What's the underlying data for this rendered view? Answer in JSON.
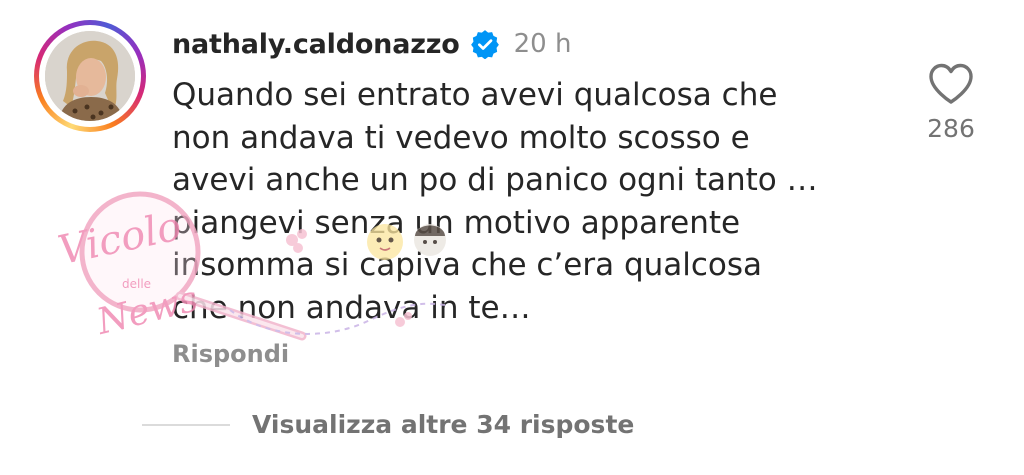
{
  "comment": {
    "username": "nathaly.caldonazzo",
    "timestamp": "20 h",
    "text": "Quando sei entrato avevi qualcosa che\nnon andava ti vedevo molto scosso e\navevi anche un po di panico ogni tanto …\npiangevi senza un motivo apparente\ninsomma si capiva che c’era qualcosa\nche non andava in te…",
    "reply_label": "Rispondi",
    "like_count": "286",
    "view_more_label": "Visualizza altre 34 risposte"
  },
  "icons": {
    "verified": "verified-badge-icon",
    "like": "heart-icon"
  },
  "colors": {
    "text": "#262626",
    "secondary": "#8e8e8e",
    "verified_blue": "#0095f6",
    "divider": "#dbdbdb"
  },
  "watermark": {
    "line1": "Vicolo",
    "line2": "delle",
    "line3": "News"
  }
}
